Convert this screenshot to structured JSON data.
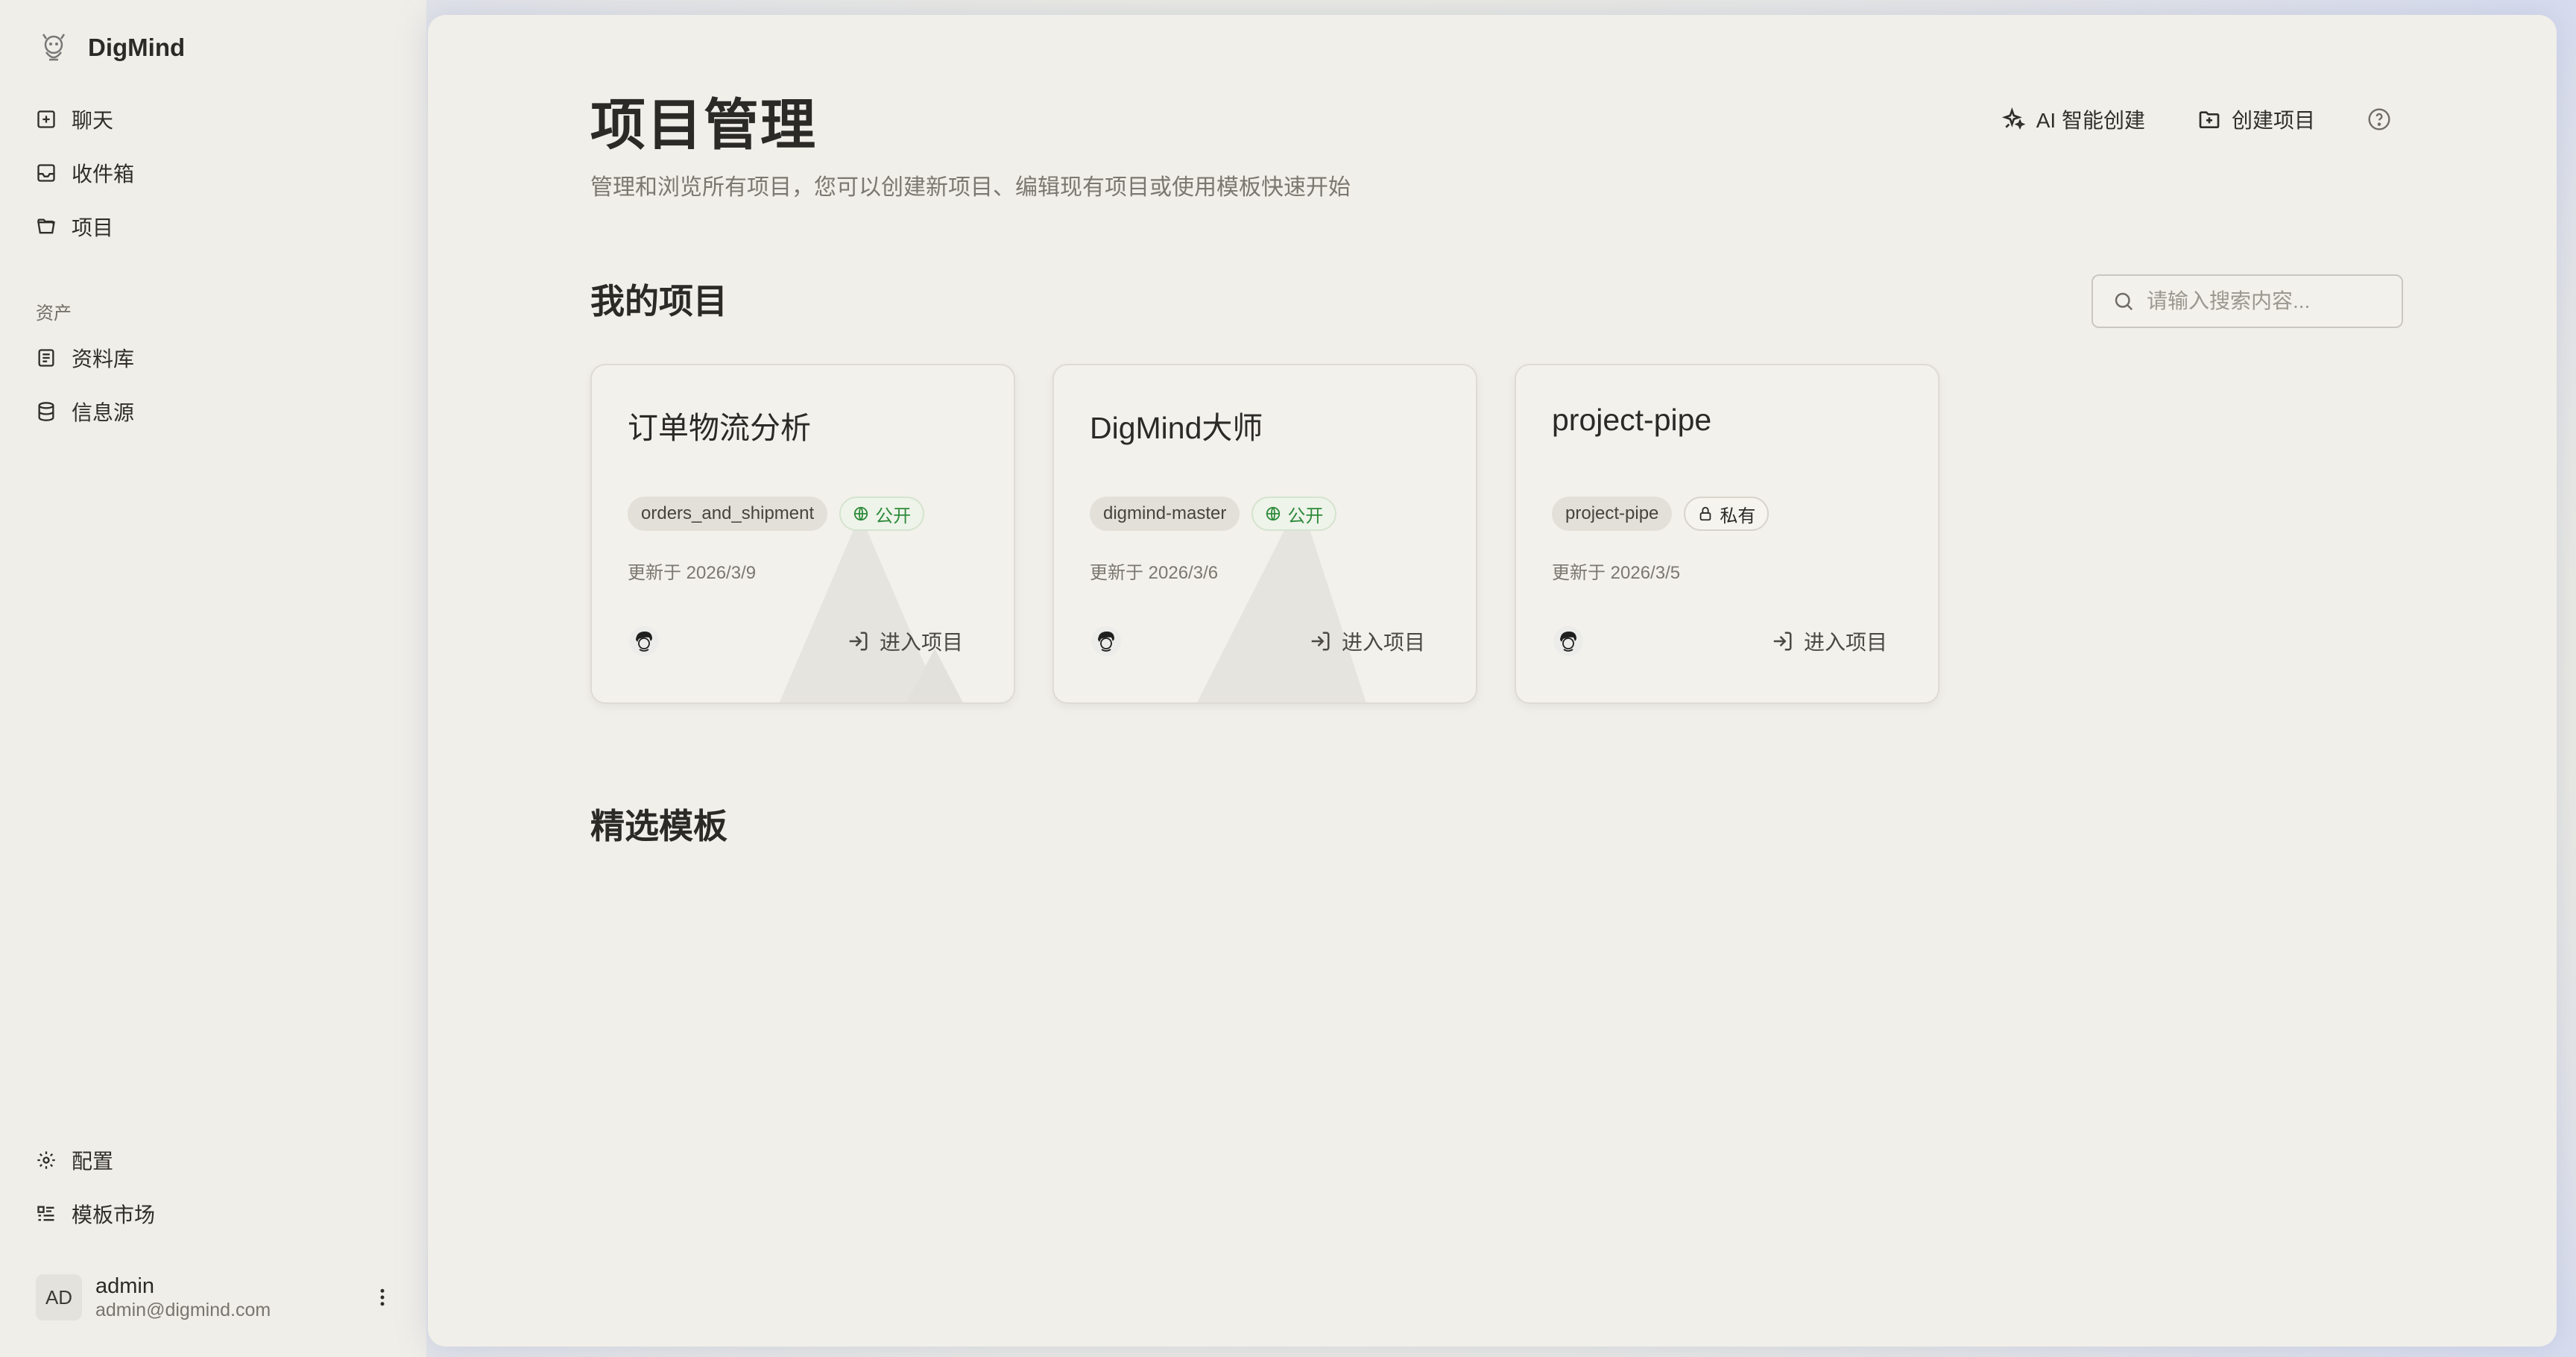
{
  "app": {
    "name": "DigMind"
  },
  "sidebar": {
    "nav": [
      {
        "label": "聊天",
        "icon": "plus-square-icon"
      },
      {
        "label": "收件箱",
        "icon": "inbox-icon"
      },
      {
        "label": "项目",
        "icon": "folder-open-icon"
      }
    ],
    "assets_label": "资产",
    "assets": [
      {
        "label": "资料库",
        "icon": "book-icon"
      },
      {
        "label": "信息源",
        "icon": "database-icon"
      }
    ],
    "bottom": [
      {
        "label": "配置",
        "icon": "gear-icon"
      },
      {
        "label": "模板市场",
        "icon": "template-list-icon"
      }
    ],
    "user": {
      "initials": "AD",
      "name": "admin",
      "email": "admin@digmind.com"
    }
  },
  "header": {
    "title": "项目管理",
    "subtitle": "管理和浏览所有项目，您可以创建新项目、编辑现有项目或使用模板快速开始",
    "ai_create_label": "AI 智能创建",
    "create_label": "创建项目"
  },
  "my_projects": {
    "title": "我的项目",
    "search_placeholder": "请输入搜索内容...",
    "projects": [
      {
        "title": "订单物流分析",
        "slug": "orders_and_shipment",
        "visibility": "公开",
        "updated": "更新于 2026/3/9",
        "enter_label": "进入项目"
      },
      {
        "title": "DigMind大师",
        "slug": "digmind-master",
        "visibility": "公开",
        "updated": "更新于 2026/3/6",
        "enter_label": "进入项目"
      },
      {
        "title": "project-pipe",
        "slug": "project-pipe",
        "visibility": "私有",
        "updated": "更新于 2026/3/5",
        "enter_label": "进入项目"
      }
    ]
  },
  "templates": {
    "title": "精选模板"
  },
  "colors": {
    "public_green": "#2e8a3b",
    "background": "#f1efe9"
  }
}
